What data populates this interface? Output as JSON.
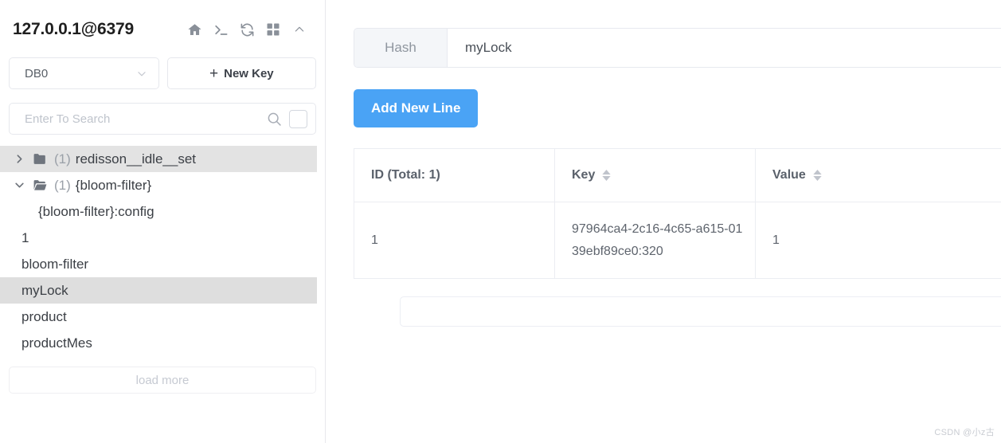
{
  "sidebar": {
    "connection_title": "127.0.0.1@6379",
    "header_icons": [
      {
        "name": "home-icon",
        "label": "Home"
      },
      {
        "name": "terminal-icon",
        "label": "Console"
      },
      {
        "name": "refresh-icon",
        "label": "Refresh"
      },
      {
        "name": "grid-icon",
        "label": "Grid View"
      },
      {
        "name": "chevron-up-icon",
        "label": "Collapse"
      }
    ],
    "db_select": {
      "value": "DB0",
      "icon": "chevron-down-icon"
    },
    "new_key_button": {
      "label": "New Key",
      "plus": "+"
    },
    "search": {
      "placeholder": "Enter To Search",
      "value": "",
      "icon": "search-icon",
      "checkbox_checked": false
    },
    "tree": [
      {
        "type": "folder",
        "expanded": false,
        "count": "(1)",
        "label": "redisson__idle__set",
        "state": "highlight"
      },
      {
        "type": "folder",
        "expanded": true,
        "count": "(1)",
        "label": "{bloom-filter}",
        "state": "none"
      },
      {
        "type": "leaf",
        "indent": true,
        "label": "{bloom-filter}:config",
        "state": "none"
      },
      {
        "type": "leaf",
        "indent": false,
        "label": "1",
        "state": "none"
      },
      {
        "type": "leaf",
        "indent": false,
        "label": "bloom-filter",
        "state": "none"
      },
      {
        "type": "leaf",
        "indent": false,
        "label": "myLock",
        "state": "selected"
      },
      {
        "type": "leaf",
        "indent": false,
        "label": "product",
        "state": "none"
      },
      {
        "type": "leaf",
        "indent": false,
        "label": "productMes",
        "state": "none"
      }
    ],
    "load_more_label": "load more"
  },
  "main": {
    "key_type": "Hash",
    "key_name": "myLock",
    "key_name_placeholder": "",
    "add_new_line_label": "Add New Line",
    "table": {
      "columns": [
        {
          "label": "ID (Total: 1)",
          "sortable": false
        },
        {
          "label": "Key",
          "sortable": true
        },
        {
          "label": "Value",
          "sortable": true
        }
      ],
      "rows": [
        {
          "id": "1",
          "key": "97964ca4-2c16-4c65-a615-0139ebf89ce0:320",
          "value": "1"
        }
      ]
    },
    "footer_input_value": ""
  },
  "watermark": "CSDN @小z古",
  "colors": {
    "accent_blue": "#4aa3f5",
    "selected_row": "#dedede",
    "highlight_row": "#e3e3e3",
    "border": "#e7e9ef",
    "tab_bg": "#f4f6f9"
  }
}
